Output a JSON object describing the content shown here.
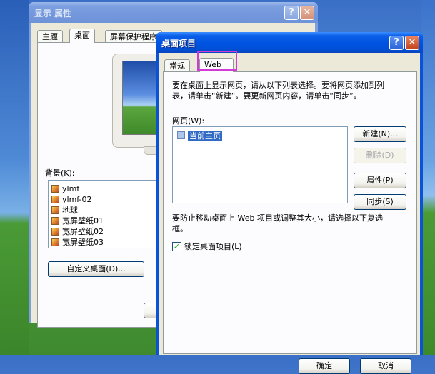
{
  "display_props": {
    "title": "显示 属性",
    "help_label": "?",
    "close_label": "✕",
    "tabs": [
      "主题",
      "桌面",
      "屏幕保护程序"
    ],
    "background_label": "背景(K):",
    "backgrounds": [
      "ylmf",
      "ylmf-02",
      "地球",
      "宽屏壁纸01",
      "宽屏壁纸02",
      "宽屏壁纸03"
    ],
    "customize_button": "自定义桌面(D)..."
  },
  "desktop_items": {
    "title": "桌面项目",
    "help_label": "?",
    "close_label": "✕",
    "tabs": [
      "常规",
      "Web"
    ],
    "description": [
      "要在桌面上显示网页，请从以下列表选择。要将网页添加到列",
      "表，请单击“新建”。要更新网页内容，请单击“同步”。"
    ],
    "webpages_label": "网页(W):",
    "webpages": [
      {
        "label": "当前主页",
        "checked": false
      }
    ],
    "buttons": {
      "new": "新建(N)...",
      "delete": "删除(D)",
      "properties": "属性(P)",
      "sync": "同步(S)"
    },
    "lock_text": [
      "要防止移动桌面上 Web 项目或调整其大小，请选择以下复选",
      "框。"
    ],
    "lock_checkbox": {
      "label": "锁定桌面项目(L)",
      "checked": true
    },
    "ok_label": "确定",
    "cancel_label": "取消"
  },
  "colors": {
    "highlight": "#d23ad6",
    "titlebar_active": "#0053e1",
    "dialog_bg": "#ece9d8"
  }
}
